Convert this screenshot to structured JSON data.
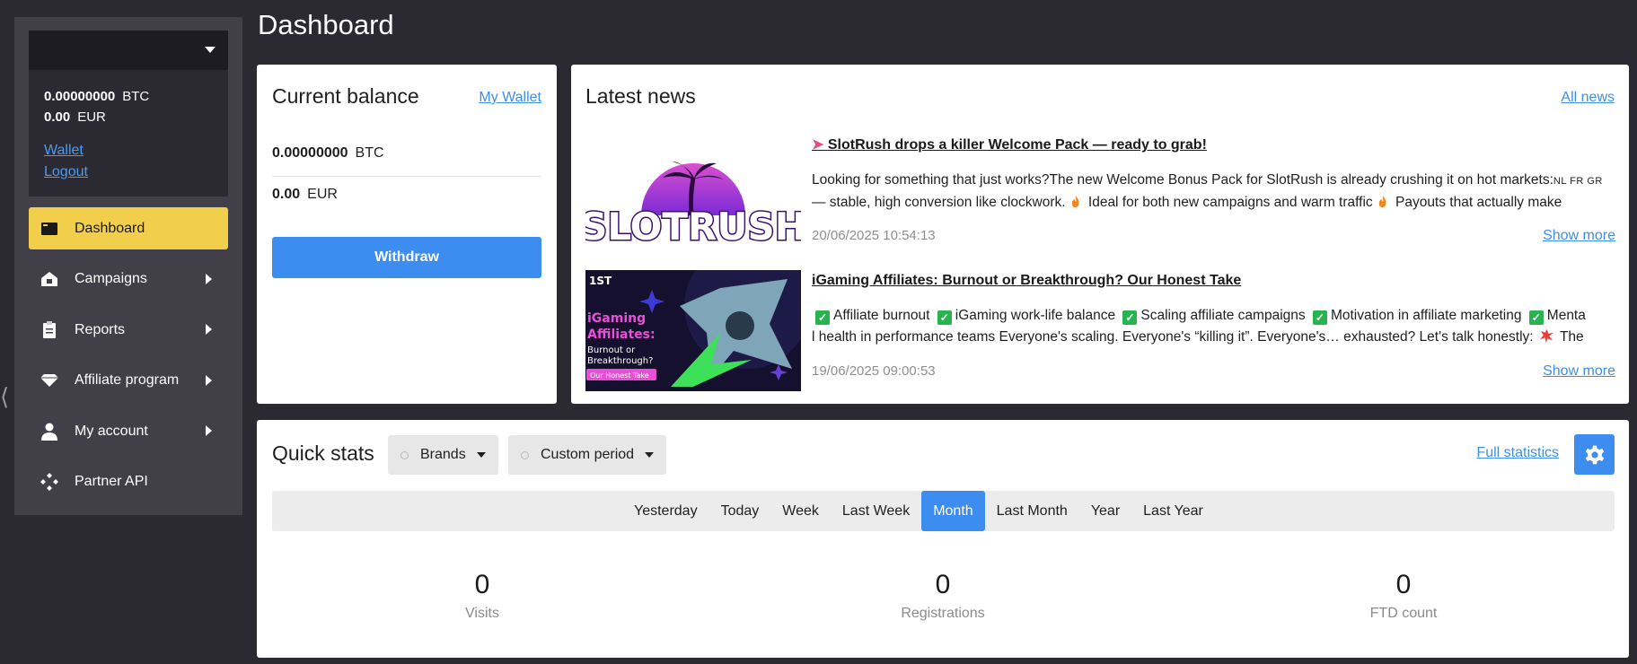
{
  "header": {
    "title": "Dashboard"
  },
  "sidebar": {
    "account": {
      "btc_value": "0.00000000",
      "btc_unit": "BTC",
      "eur_value": "0.00",
      "eur_unit": "EUR",
      "wallet_link": "Wallet",
      "logout_link": "Logout"
    },
    "items": [
      {
        "label": "Dashboard",
        "icon": "dashboard-icon",
        "active": true
      },
      {
        "label": "Campaigns",
        "icon": "campaigns-icon"
      },
      {
        "label": "Reports",
        "icon": "reports-icon"
      },
      {
        "label": "Affiliate program",
        "icon": "diamond-icon"
      },
      {
        "label": "My account",
        "icon": "user-icon"
      },
      {
        "label": "Partner API",
        "icon": "api-icon"
      }
    ]
  },
  "balance": {
    "title": "Current balance",
    "wallet_link": "My Wallet",
    "btc_value": "0.00000000",
    "btc_unit": "BTC",
    "eur_value": "0.00",
    "eur_unit": "EUR",
    "withdraw_label": "Withdraw"
  },
  "news": {
    "title": "Latest news",
    "all_link": "All news",
    "items": [
      {
        "headline": "SlotRush drops a killer Welcome Pack — ready to grab!",
        "text_1": "Looking for something that just works?The new Welcome Bonus Pack for SlotRush is already crushing it on hot markets:",
        "markets": "NL FR GR",
        "text_2": "— stable, high conversion like clockwork.",
        "text_3": "Ideal for both new campaigns and warm traffic",
        "text_4": "Payouts that actually make sense…",
        "thumb_text": "SLOTRUSH",
        "date": "20/06/2025 10:54:13",
        "more": "Show more"
      },
      {
        "headline": "iGaming Affiliates: Burnout or Breakthrough? Our Honest Take",
        "c1": "Affiliate burnout",
        "c2": "iGaming work-life balance",
        "c3": "Scaling affiliate campaigns",
        "c4": "Motivation in affiliate marketing",
        "c5_a": "Menta",
        "c5_b": "l health in performance teams Everyone's scaling. Everyone's “killing it”. Everyone's… exhausted? Let's talk honestly:",
        "text_end": "The gri…",
        "thumb_brand": "1ST",
        "thumb_line1": "iGaming",
        "thumb_line2": "Affiliates:",
        "thumb_line3": "Burnout or",
        "thumb_line4": "Breakthrough?",
        "thumb_tag": "Our Honest Take",
        "date": "19/06/2025 09:00:53",
        "more": "Show more"
      }
    ]
  },
  "stats": {
    "title": "Quick stats",
    "brands_label": "Brands",
    "period_label": "Custom period",
    "full_link": "Full statistics",
    "periods": [
      "Yesterday",
      "Today",
      "Week",
      "Last Week",
      "Month",
      "Last Month",
      "Year",
      "Last Year"
    ],
    "active_period": "Month",
    "metrics": [
      {
        "value": "0",
        "label": "Visits"
      },
      {
        "value": "0",
        "label": "Registrations"
      },
      {
        "value": "0",
        "label": "FTD count"
      }
    ]
  },
  "colors": {
    "accent": "#3d8df1",
    "active_nav": "#f2cf4a",
    "background": "#2b2a33",
    "sidebar": "#414049"
  }
}
